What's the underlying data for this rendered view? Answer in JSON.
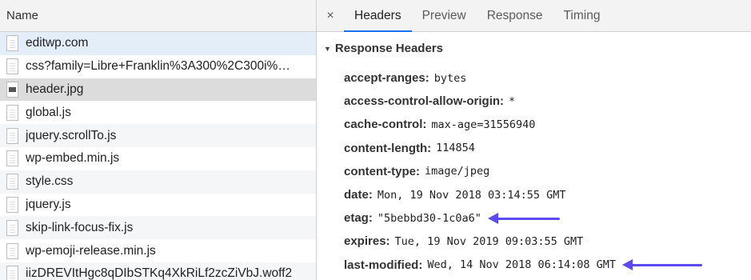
{
  "files": {
    "column_header": "Name",
    "items": [
      {
        "name": "editwp.com",
        "icon": "document-icon"
      },
      {
        "name": "css?family=Libre+Franklin%3A300%2C300i%…",
        "icon": "document-icon"
      },
      {
        "name": "header.jpg",
        "icon": "image-file-icon"
      },
      {
        "name": "global.js",
        "icon": "document-icon"
      },
      {
        "name": "jquery.scrollTo.js",
        "icon": "document-icon"
      },
      {
        "name": "wp-embed.min.js",
        "icon": "document-icon"
      },
      {
        "name": "style.css",
        "icon": "document-icon"
      },
      {
        "name": "jquery.js",
        "icon": "document-icon"
      },
      {
        "name": "skip-link-focus-fix.js",
        "icon": "document-icon"
      },
      {
        "name": "wp-emoji-release.min.js",
        "icon": "document-icon"
      },
      {
        "name": "iizDREVItHgc8qDIbSTKq4XkRiLf2zcZiVbJ.woff2",
        "icon": "document-icon"
      }
    ]
  },
  "details": {
    "close_glyph": "×",
    "tabs": [
      "Headers",
      "Preview",
      "Response",
      "Timing"
    ],
    "active_tab": "Headers",
    "section_toggle": "▼",
    "section_title": "Response Headers",
    "headers": [
      {
        "key": "accept-ranges:",
        "value": "bytes"
      },
      {
        "key": "access-control-allow-origin:",
        "value": "*"
      },
      {
        "key": "cache-control:",
        "value": "max-age=31556940"
      },
      {
        "key": "content-length:",
        "value": "114854"
      },
      {
        "key": "content-type:",
        "value": "image/jpeg"
      },
      {
        "key": "date:",
        "value": "Mon, 19 Nov 2018 03:14:55 GMT"
      },
      {
        "key": "etag:",
        "value": "\"5bebbd30-1c0a6\""
      },
      {
        "key": "expires:",
        "value": "Tue, 19 Nov 2019 09:03:55 GMT"
      },
      {
        "key": "last-modified:",
        "value": "Wed, 14 Nov 2018 06:14:08 GMT"
      }
    ]
  },
  "colors": {
    "annotation_arrow": "#5b4af0",
    "active_tab_underline": "#1a73e8"
  }
}
